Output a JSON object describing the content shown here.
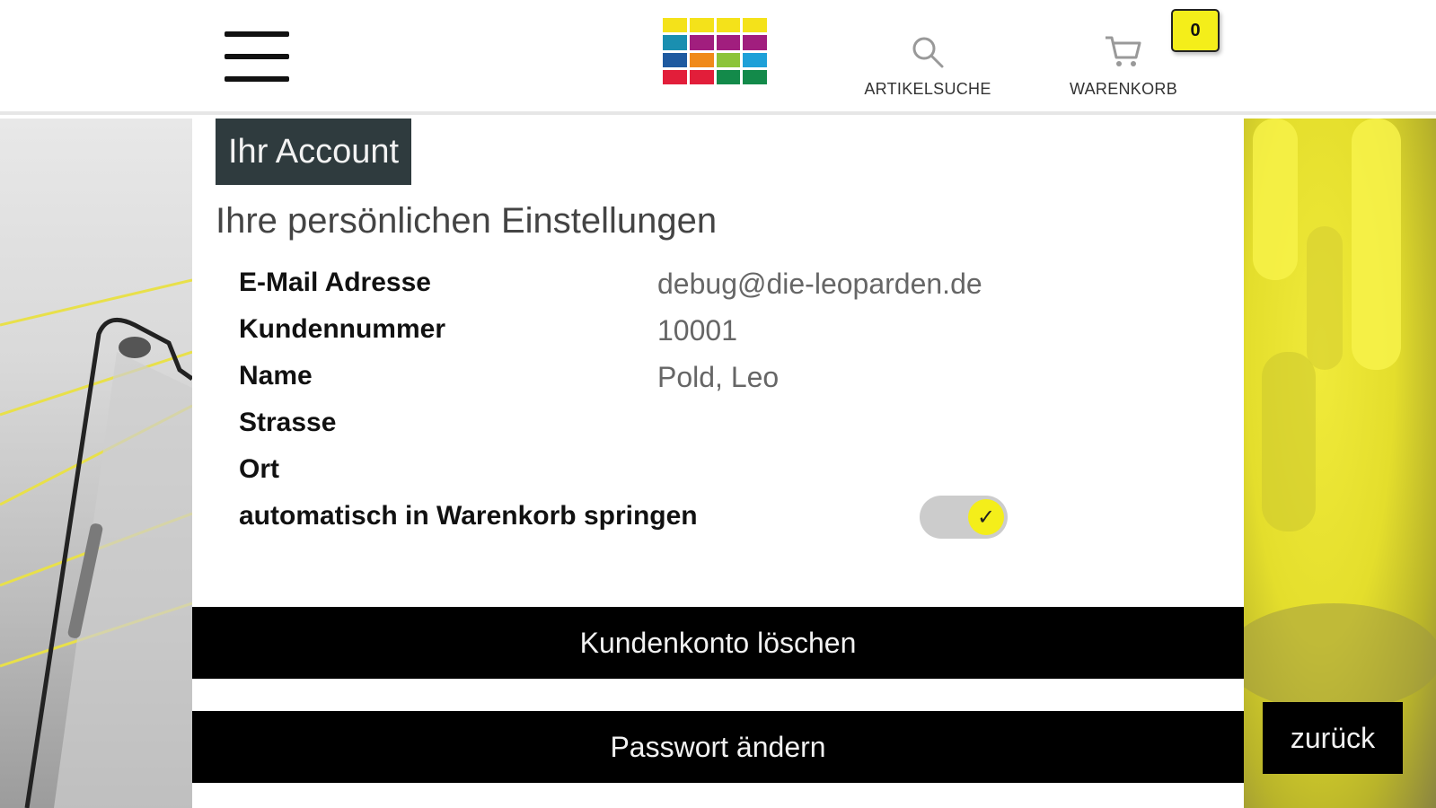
{
  "header": {
    "menu_icon": "hamburger-menu-icon",
    "logo_colors": [
      "#f4e21a",
      "#f4e21a",
      "#f4e21a",
      "#f4e21a",
      "#1a8fb0",
      "#a11e7e",
      "#a11e7e",
      "#a11e7e",
      "#1e5aa0",
      "#f08a1a",
      "#8cc43a",
      "#1ea0d8",
      "#e21e3a",
      "#e21e3a",
      "#138a4a",
      "#138a4a"
    ],
    "search": {
      "icon": "search-icon",
      "label": "ARTIKELSUCHE"
    },
    "cart": {
      "icon": "cart-icon",
      "label": "WARENKORB",
      "count": "0"
    }
  },
  "account": {
    "tag": "Ihr Account",
    "subtitle": "Ihre persönlichen Einstellungen",
    "fields": [
      {
        "label": "E-Mail Adresse",
        "value": "debug@die-leoparden.de"
      },
      {
        "label": "Kundennummer",
        "value": "10001"
      },
      {
        "label": "Name",
        "value": "Pold, Leo"
      },
      {
        "label": "Strasse",
        "value": ""
      },
      {
        "label": "Ort",
        "value": ""
      }
    ],
    "toggle": {
      "label": "automatisch in Warenkorb springen",
      "checked": true,
      "icon": "check-icon"
    }
  },
  "buttons": {
    "delete_account": "Kundenkonto löschen",
    "change_password": "Passwort ändern",
    "back": "zurück"
  },
  "colors": {
    "accent": "#f4ee1a",
    "dark_tag": "#2f3b3e",
    "button": "#000000"
  }
}
